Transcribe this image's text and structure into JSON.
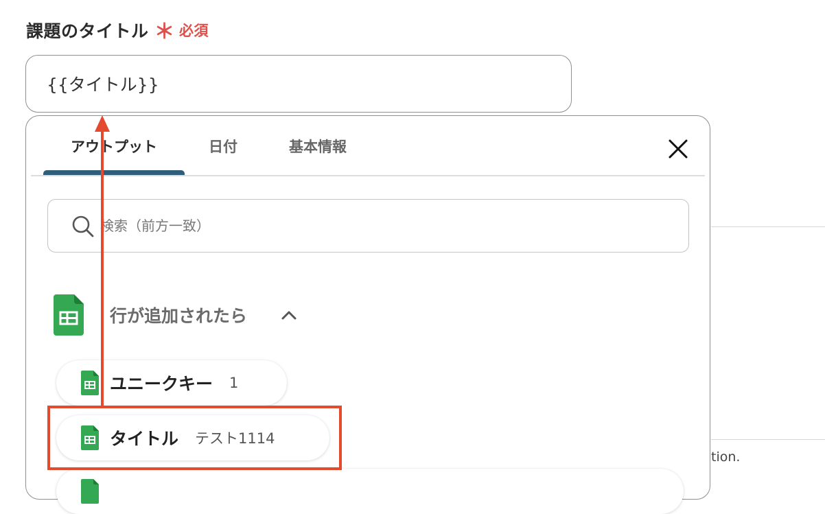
{
  "field": {
    "label": "課題のタイトル",
    "required_mark": "＊",
    "required_text": "必須",
    "value": "{{タイトル}}",
    "required_color": "#e0504b"
  },
  "popup": {
    "tabs": [
      {
        "label": "アウトプット",
        "active": true
      },
      {
        "label": "日付",
        "active": false
      },
      {
        "label": "基本情報",
        "active": false
      }
    ],
    "close_icon": "close-icon",
    "search": {
      "placeholder": "検索（前方一致）",
      "value": "",
      "icon": "search-icon"
    },
    "section": {
      "title": "行が追加されたら",
      "icon": "google-sheets-icon",
      "expanded": true
    },
    "items": [
      {
        "label": "ユニークキー",
        "value": "1"
      },
      {
        "label": "タイトル",
        "value": "テスト1114",
        "highlighted": true
      },
      {
        "label": "",
        "value": ""
      }
    ]
  },
  "background": {
    "partial_text": "tion."
  },
  "colors": {
    "tab_underline": "#2f5d7a",
    "highlight": "#e34a2e",
    "sheets_green": "#34a853"
  }
}
